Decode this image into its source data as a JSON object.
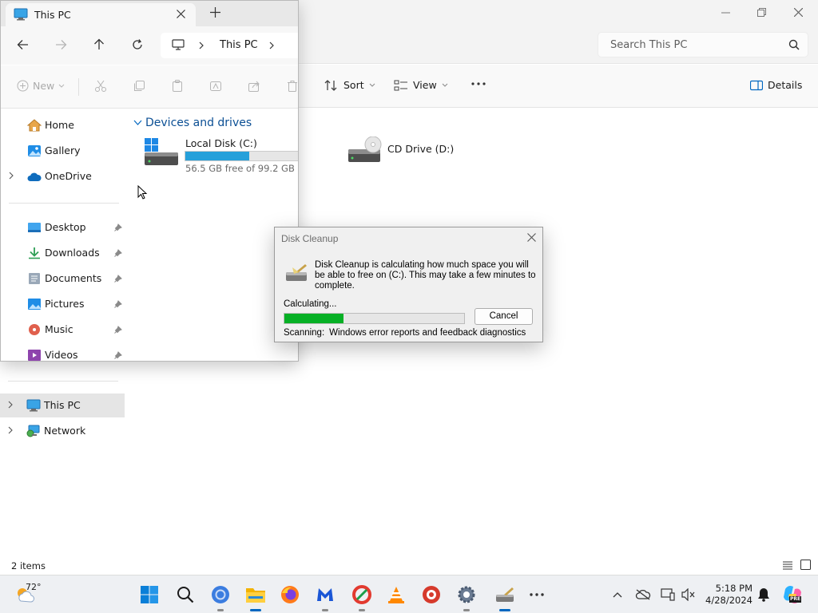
{
  "explorer": {
    "search_placeholder": "Search This PC",
    "toolbar": {
      "sort_label": "Sort",
      "view_label": "View",
      "details_label": "Details"
    },
    "nav": {
      "this_pc": "This PC",
      "network": "Network"
    },
    "drives": [
      {
        "name": "Local Disk (C:)"
      },
      {
        "name": "CD Drive (D:)"
      }
    ],
    "status": "2 items"
  },
  "floating_window": {
    "tab_title": "This PC",
    "breadcrumb": "This PC",
    "new_label": "New",
    "section_title": "Devices and drives",
    "drive_c": {
      "name": "Local Disk (C:)",
      "free_text": "56.5 GB free of 99.2 GB",
      "used_fraction": 0.43
    },
    "nav_items": [
      {
        "label": "Home",
        "icon": "home-icon"
      },
      {
        "label": "Gallery",
        "icon": "gallery-icon"
      },
      {
        "label": "OneDrive",
        "icon": "onedrive-icon"
      },
      {
        "label": "Desktop",
        "icon": "desktop-folder-icon",
        "pinned": true
      },
      {
        "label": "Downloads",
        "icon": "downloads-icon",
        "pinned": true
      },
      {
        "label": "Documents",
        "icon": "documents-icon",
        "pinned": true
      },
      {
        "label": "Pictures",
        "icon": "pictures-icon",
        "pinned": true
      },
      {
        "label": "Music",
        "icon": "music-icon",
        "pinned": true
      },
      {
        "label": "Videos",
        "icon": "videos-icon",
        "pinned": true
      }
    ]
  },
  "dialog": {
    "title": "Disk Cleanup",
    "message": "Disk Cleanup is calculating how much space you will be able to free on  (C:). This may take a few minutes to complete.",
    "calculating_label": "Calculating...",
    "progress": 0.33,
    "cancel_label": "Cancel",
    "scanning_label": "Scanning:",
    "scanning_item": "Windows error reports and feedback diagnostics"
  },
  "taskbar": {
    "weather_temp": "72°",
    "time": "5:18 PM",
    "date": "4/28/2024",
    "pre_badge": "PRE"
  },
  "colors": {
    "accent": "#0067c0",
    "progress_green": "#06b025",
    "drive_bar": "#26a0da"
  }
}
